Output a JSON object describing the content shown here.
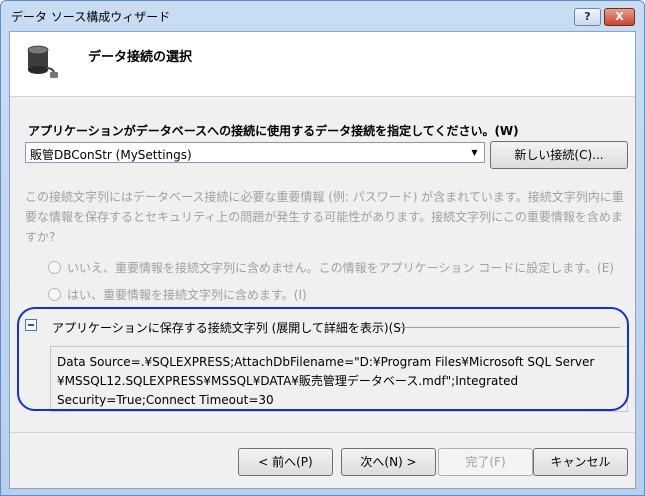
{
  "window": {
    "title": "データ ソース構成ウィザード",
    "help_label": "?",
    "close_label": "X"
  },
  "header": {
    "title": "データ接続の選択",
    "icon": "database-plug-icon"
  },
  "prompt": "アプリケーションがデータベースへの接続に使用するデータ接続を指定してください。(W)",
  "connection": {
    "selected": "販管DBConStr (MySettings)",
    "new_button": "新しい接続(C)..."
  },
  "warning": "この接続文字列にはデータベース接続に必要な重要情報 (例: パスワード) が含まれています。接続文字列内に重要な情報を保存するとセキュリティ上の問題が発生する可能性があります。接続文字列にこの重要情報を含めますか?",
  "options": [
    {
      "label": "いいえ、重要情報を接続文字列に含めません。この情報をアプリケーション コードに設定します。(E)"
    },
    {
      "label": "はい、重要情報を接続文字列に含めます。(I)"
    }
  ],
  "expander": {
    "label": "アプリケーションに保存する接続文字列 (展開して詳細を表示)(S)",
    "expanded": true
  },
  "connection_string": "Data Source=.¥SQLEXPRESS;AttachDbFilename=\"D:¥Program Files¥Microsoft SQL Server ¥MSSQL12.SQLEXPRESS¥MSSQL¥DATA¥販売管理データベース.mdf\";Integrated Security=True;Connect Timeout=30",
  "footer": {
    "prev": "< 前へ(P)",
    "next": "次へ(N) >",
    "finish": "完了(F)",
    "cancel": "キャンセル"
  },
  "colors": {
    "highlight": "#1133cc",
    "titlebar": "#b7cfee",
    "disabled_text": "#a0a0a0"
  }
}
